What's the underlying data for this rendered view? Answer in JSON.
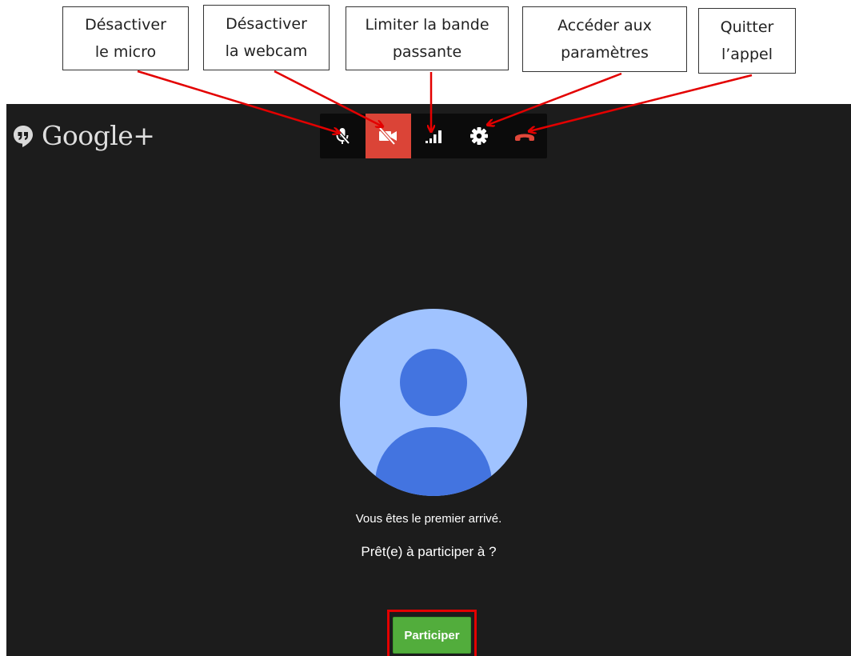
{
  "annotations": {
    "mute_mic": [
      "Désactiver",
      "le micro"
    ],
    "disable_webcam": [
      "Désactiver",
      "la webcam"
    ],
    "limit_bandwidth": [
      "Limiter la bande",
      "passante"
    ],
    "settings": [
      "Accéder aux",
      "paramètres"
    ],
    "quit_call": [
      "Quitter",
      "l’appel"
    ]
  },
  "brand": {
    "name": "Google+"
  },
  "toolbar": {
    "buttons": [
      {
        "icon": "mic-off-icon",
        "active": false
      },
      {
        "icon": "webcam-off-icon",
        "active": true
      },
      {
        "icon": "bandwidth-icon",
        "active": false
      },
      {
        "icon": "gear-icon",
        "active": false
      },
      {
        "icon": "hang-up-icon",
        "active": false
      }
    ]
  },
  "main": {
    "first_arrival": "Vous êtes le premier arrivé.",
    "ready_prompt": "Prêt(e) à participer à  ?",
    "join_label": "Participer"
  },
  "colors": {
    "window_background": "#1c1c1c",
    "toolbar_background": "#0b0b0b",
    "active_button": "#db4437",
    "hang_up": "#e0473a",
    "avatar_light": "#a0c3ff",
    "avatar_dark": "#4374e0",
    "join_button": "#52ad3c",
    "annotation_red": "#e30000"
  }
}
